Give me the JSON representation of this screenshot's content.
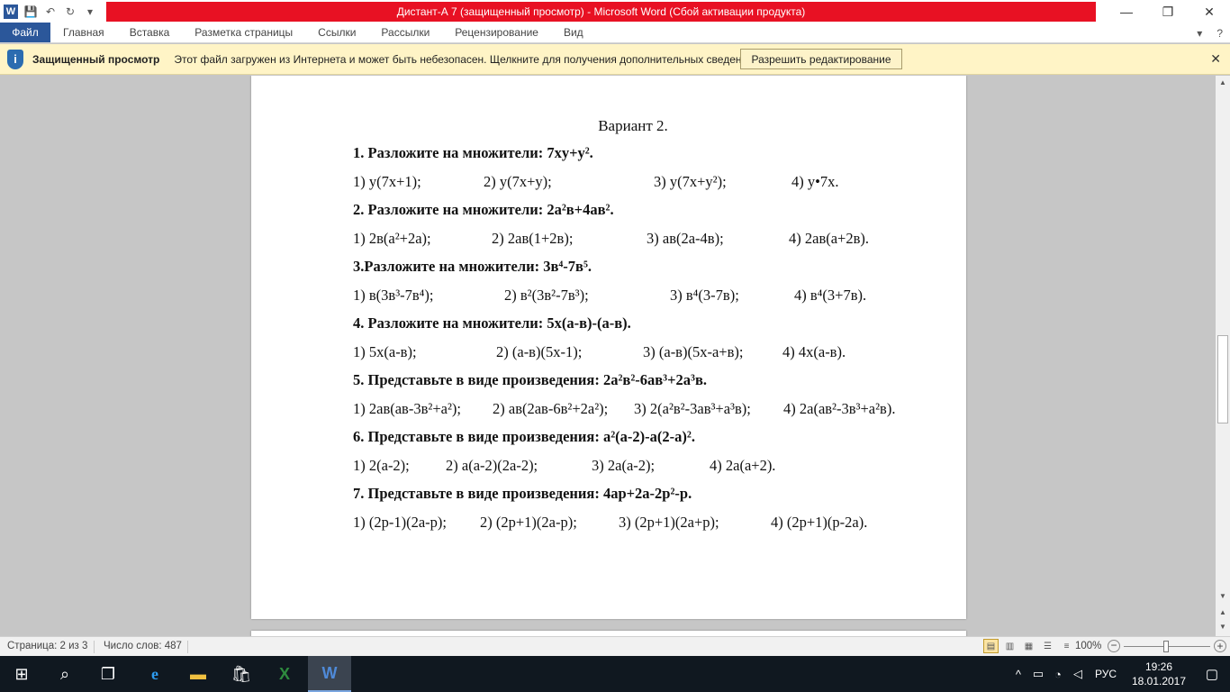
{
  "window": {
    "title": "Дистант-А 7 (защищенный просмотр)  -  Microsoft Word (Сбой активации продукта)",
    "controls": {
      "minimize": "—",
      "maximize": "❐",
      "close": "✕"
    }
  },
  "ribbon": {
    "tabs": [
      "Файл",
      "Главная",
      "Вставка",
      "Разметка страницы",
      "Ссылки",
      "Рассылки",
      "Рецензирование",
      "Вид"
    ]
  },
  "message_bar": {
    "title": "Защищенный просмотр",
    "text": "Этот файл загружен из Интернета и может быть небезопасен. Щелкните для получения дополнительных сведений.",
    "button": "Разрешить редактирование",
    "close": "✕"
  },
  "document": {
    "title": "Вариант 2.",
    "questions": [
      {
        "q": "1. Разложите на множители: 7xy+y²."
      },
      {
        "q": "2. Разложите на множители: 2a²в+4aв²."
      },
      {
        "q": "3.Разложите на множители: 3в⁴-7в⁵."
      },
      {
        "q": "4. Разложите на множители: 5x(a-в)-(a-в)."
      },
      {
        "q": "5. Представьте в виде произведения: 2a²в²-6aв³+2a³в."
      },
      {
        "q": "6. Представьте в виде произведения: a²(a-2)-a(2-a)²."
      },
      {
        "q": "7. Представьте в виде произведения: 4ap+2a-2p²-p."
      }
    ],
    "answers": [
      [
        "1) y(7x+1);",
        "2) y(7x+y);",
        "3) y(7x+y²);",
        "4) y•7x."
      ],
      [
        "1) 2в(a²+2a);",
        "2) 2aв(1+2в);",
        "3) aв(2a-4в);",
        "4) 2aв(a+2в)."
      ],
      [
        "1) в(3в³-7в⁴);",
        "2) в²(3в²-7в³);",
        "3) в⁴(3-7в);",
        "4) в⁴(3+7в)."
      ],
      [
        "1) 5x(a-в);",
        "2) (a-в)(5x-1);",
        "3) (a-в)(5x-a+в);",
        "4) 4x(a-в)."
      ],
      [
        "1) 2aв(aв-3в²+a²);",
        "2) aв(2aв-6в²+2a²);",
        "3) 2(a²в²-3aв³+a³в);",
        "4) 2a(aв²-3в³+a²в)."
      ],
      [
        "1) 2(a-2);",
        "2) a(a-2)(2a-2);",
        "3) 2a(a-2);",
        "4) 2a(a+2)."
      ],
      [
        "1) (2p-1)(2a-p);",
        "2) (2p+1)(2a-p);",
        "3) (2p+1)(2a+p);",
        "4) (2p+1)(p-2a)."
      ]
    ]
  },
  "status_bar": {
    "page": "Страница: 2 из 3",
    "words": "Число слов: 487",
    "zoom": "100%",
    "zoom_fraction": 0.5
  },
  "taskbar": {
    "language": "РУС",
    "time": "19:26",
    "date": "18.01.2017"
  }
}
